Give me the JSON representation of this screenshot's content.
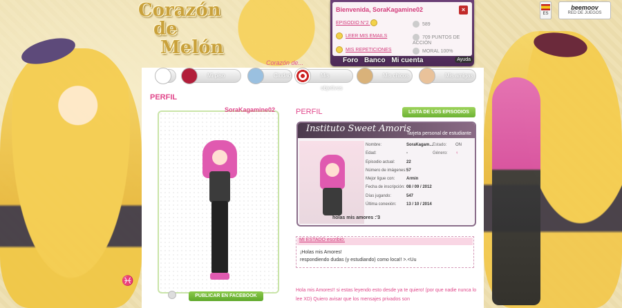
{
  "site": {
    "logo_line1": "Corazón",
    "logo_line2": "de",
    "logo_line3": "Melón",
    "tagline": "Corazón de..."
  },
  "welcome": {
    "title": "Bienvenida, SoraKagamine02",
    "episode_label": "EPISODIO N°2",
    "rows": [
      {
        "label": "LEER MIS EMAILS",
        "stat": "709 PUNTOS DE ACCIÓN"
      },
      {
        "label": "MIS REPETICIONES",
        "stat": "MORAL 100%"
      }
    ],
    "coins": "589",
    "links": [
      "Foro",
      "Banco",
      "Mi cuenta"
    ],
    "help": "Ayuda"
  },
  "top_right": {
    "lang": "ES",
    "beemoov_brand": "beemoov",
    "beemoov_sub": "RED DE JUEGOS"
  },
  "nav": [
    {
      "label": "",
      "icon": "home-icon"
    },
    {
      "label": "Mi piso",
      "icon": "sofa-icon"
    },
    {
      "label": "Ciudad",
      "icon": "city-icon"
    },
    {
      "label": "Mis objetivos",
      "icon": "target-icon"
    },
    {
      "label": "Mis chicos",
      "icon": "boys-icon"
    },
    {
      "label": "Mis amigas",
      "icon": "girls-icon"
    }
  ],
  "profile": {
    "title": "PERFIL",
    "username": "SoraKagamine02",
    "facebook_button": "PUBLICAR EN FACEBOOK",
    "zodiac": "♓",
    "section_title": "PERFIL",
    "episodes_button": "LISTA DE LOS EPISODIOS"
  },
  "idcard": {
    "school": "Instituto Sweet Amoris",
    "subtitle": "Tarjeta personal de estudiante",
    "rows": [
      {
        "k": "Nombre:",
        "v": "SoraKagam...",
        "k2": "Estado:",
        "v2": "ON"
      },
      {
        "k": "Edad:",
        "v": "-",
        "k2": "Género:",
        "v2": "♀"
      },
      {
        "k": "Episodio actual:",
        "v": "22",
        "k2": "",
        "v2": ""
      },
      {
        "k": "Número de imágenes:",
        "v": "57",
        "k2": "",
        "v2": ""
      },
      {
        "k": "Mejor ligue con:",
        "v": "Armin",
        "k2": "",
        "v2": ""
      },
      {
        "k": "Fecha de inscripción:",
        "v": "08 / 09 / 2012",
        "k2": "",
        "v2": ""
      },
      {
        "k": "Días jugando:",
        "v": "547",
        "k2": "",
        "v2": ""
      },
      {
        "k": "Última conexión:",
        "v": "13 / 10 / 2014",
        "k2": "",
        "v2": ""
      }
    ],
    "motto": "holas mis amores :'3"
  },
  "status": {
    "header": "MI ESTADO escribió:",
    "line1": "¡Holas mis Amores!",
    "line2": "respondiendo dudas (y estudiando) como loca!! >.<Uu"
  },
  "bio": {
    "text": "Hola mis Amores!! si estas leyendo esto desde ya te quiero! (por que nadie nunca lo lee XD) Quiero avisar que los mensajes privados son"
  }
}
